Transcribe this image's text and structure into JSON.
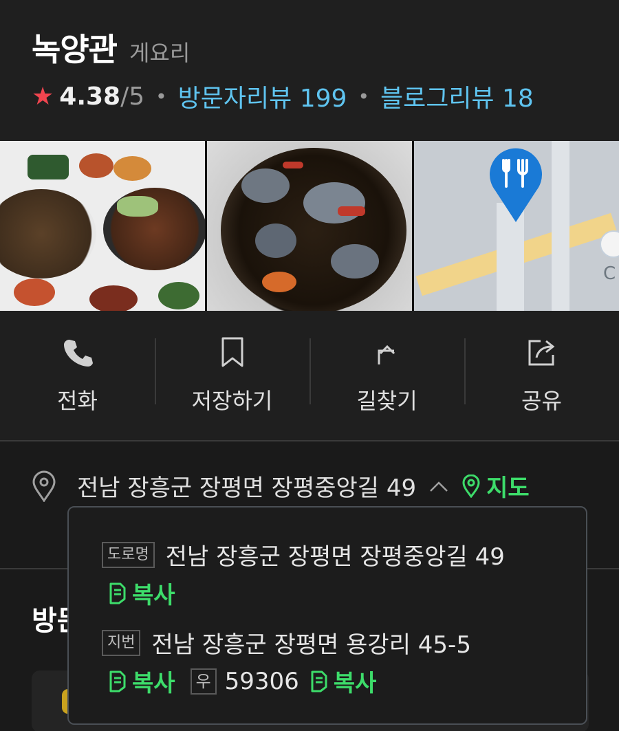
{
  "place": {
    "name": "녹양관",
    "category": "게요리",
    "rating": "4.38",
    "rating_max": "/5",
    "visitor_reviews": "방문자리뷰 199",
    "blog_reviews": "블로그리뷰 18"
  },
  "actions": [
    {
      "label": "전화",
      "icon": "phone-icon"
    },
    {
      "label": "저장하기",
      "icon": "bookmark-icon"
    },
    {
      "label": "길찾기",
      "icon": "directions-icon"
    },
    {
      "label": "공유",
      "icon": "share-icon"
    }
  ],
  "address": {
    "summary": "전남 장흥군 장평면 장평중앙길 49",
    "map_label": "지도"
  },
  "popup": {
    "road_tag": "도로명",
    "road_address": "전남 장흥군 장평면 장평중앙길 49",
    "lot_tag": "지번",
    "lot_address": "전남 장흥군 장평면 용강리 45-5",
    "copy_label": "복사",
    "zip_tag": "우",
    "zip_code": "59306"
  },
  "section": {
    "title_partial": "방문"
  },
  "colors": {
    "accent_green": "#3ddc6a",
    "link_blue": "#5fc4f0",
    "star_red": "#f0454f",
    "pin_blue": "#1a7ad6"
  }
}
